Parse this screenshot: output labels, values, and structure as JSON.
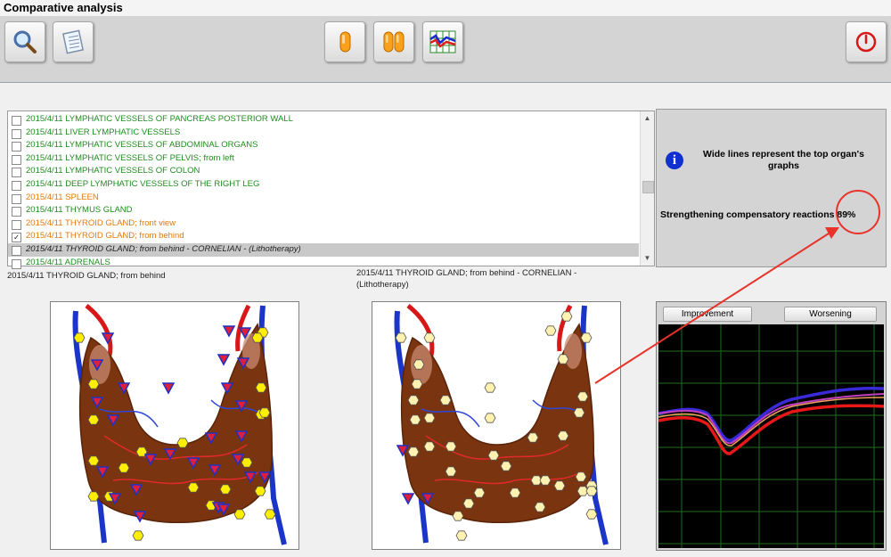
{
  "window": {
    "title": "Comparative analysis"
  },
  "toolbar": {
    "left_buttons": [
      {
        "icon": "magnifier-icon"
      },
      {
        "icon": "notepad-icon"
      }
    ],
    "center_buttons": [
      {
        "icon": "single-capsule-icon"
      },
      {
        "icon": "double-capsule-icon"
      },
      {
        "icon": "graph-icon"
      }
    ],
    "right_buttons": [
      {
        "icon": "power-icon"
      }
    ]
  },
  "list": {
    "rows": [
      {
        "text": "2015/4/11  LYMPHATIC VESSELS OF PANCREAS POSTERIOR WALL",
        "color": "green",
        "checked": false,
        "selected": false
      },
      {
        "text": "2015/4/11  LIVER LYMPHATIC VESSELS",
        "color": "green",
        "checked": false,
        "selected": false
      },
      {
        "text": "2015/4/11  LYMPHATIC VESSELS OF ABDOMINAL ORGANS",
        "color": "green",
        "checked": false,
        "selected": false
      },
      {
        "text": "2015/4/11  LYMPHATIC VESSELS OF PELVIS; from left",
        "color": "green",
        "checked": false,
        "selected": false
      },
      {
        "text": "2015/4/11  LYMPHATIC VESSELS OF COLON",
        "color": "green",
        "checked": false,
        "selected": false
      },
      {
        "text": "2015/4/11  DEEP  LYMPHATIC  VESSELS  OF  THE  RIGHT  LEG",
        "color": "green",
        "checked": false,
        "selected": false
      },
      {
        "text": "2015/4/11  SPLEEN",
        "color": "orange",
        "checked": false,
        "selected": false
      },
      {
        "text": "2015/4/11  THYMUS GLAND",
        "color": "green",
        "checked": false,
        "selected": false
      },
      {
        "text": "2015/4/11  THYROID GLAND; front view",
        "color": "orange",
        "checked": false,
        "selected": false
      },
      {
        "text": "2015/4/11  THYROID GLAND; from behind",
        "color": "orange",
        "checked": true,
        "selected": false
      },
      {
        "text": "2015/4/11  THYROID GLAND; from behind - CORNELIAN - (Lithotherapy)",
        "color": "dark",
        "checked": false,
        "selected": true
      },
      {
        "text": "2015/4/11  ADRENALS",
        "color": "green",
        "checked": false,
        "selected": false
      }
    ]
  },
  "info": {
    "icon": "info-icon",
    "message": "Wide lines represent the top organ's graphs",
    "strength_text": "Strengthening compensatory reactions 89%"
  },
  "captions": {
    "left": "2015/4/11  THYROID GLAND; from behind",
    "right": "2015/4/11  THYROID GLAND; from behind - CORNELIAN - (Lithotherapy)"
  },
  "graph": {
    "improvement_label": "Improvement",
    "worsening_label": "Worsening"
  },
  "colors": {
    "annotation": "#e8322a",
    "green_text": "#1e8c1e",
    "orange_text": "#e07a10",
    "organ": "#7a3410",
    "hexagon_fill_bright": "#ffee00",
    "hexagon_fill_pale": "#fff2b0",
    "triangle_fill": "#dd1e3c",
    "triangle_edge": "#2030c0"
  }
}
